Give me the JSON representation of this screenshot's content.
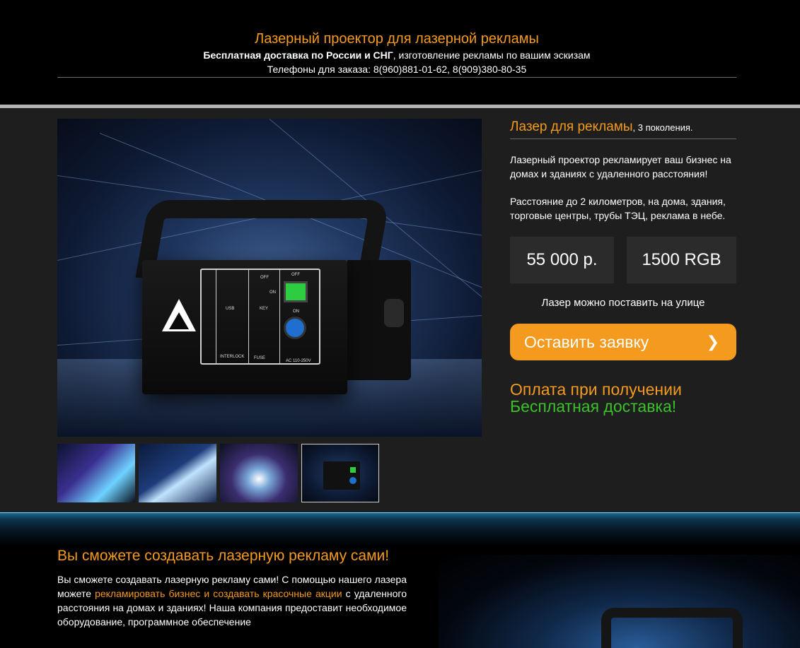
{
  "header": {
    "title": "Лазерный проектор для лазерной рекламы",
    "delivery_bold": "Бесплатная доставка по России и СНГ",
    "delivery_rest": ", изготовление рекламы по вашим эскизам",
    "phones": "Телефоны для заказа: 8(960)881-01-62, 8(909)380-80-35"
  },
  "product": {
    "title": "Лазер для рекламы",
    "generation": ", 3 поколения.",
    "description": "Лазерный проектор рекламирует ваш бизнес на домах и зданиях с удаленного расстояния!",
    "distance": "Расстояние до 2 километров, на дома, здания, торговые центры, трубы ТЭЦ, реклама в небе.",
    "price": "55 000 р.",
    "model": "1500 RGB",
    "street_note": "Лазер можно поставить на улице",
    "cta_label": "Оставить заявку",
    "cta_icon": "chevron-right-icon",
    "payment": "Оплата при получении",
    "free_delivery": "Бесплатная доставка!",
    "panel_labels": {
      "usb": "USB",
      "key": "KEY",
      "off1": "OFF",
      "on1": "ON",
      "off2": "OFF",
      "on2": "ON",
      "interlock": "INTERLOCK",
      "fuse": "FUSE",
      "ac": "AC 110-250V"
    },
    "thumbnails": [
      {
        "name": "laser-show-1",
        "selected": false
      },
      {
        "name": "laser-show-2",
        "selected": false
      },
      {
        "name": "laser-show-3",
        "selected": false
      },
      {
        "name": "laser-device",
        "selected": true
      }
    ]
  },
  "section": {
    "title": "Вы сможете создавать лазерную рекламу сами!",
    "text_start": "Вы сможете создавать лазерную рекламу сами! С помощью нашего лазера можете ",
    "text_highlight": "рекламировать бизнес и создавать красочные акции",
    "text_end": " с удаленного расстояния на домах и зданиях! Наша компания предоставит необходимое оборудование, программное обеспечение"
  },
  "colors": {
    "accent": "#f39a1f",
    "green": "#3cc12b",
    "panel_bg": "#1e1e1e",
    "box_bg": "#2b2b2b"
  }
}
